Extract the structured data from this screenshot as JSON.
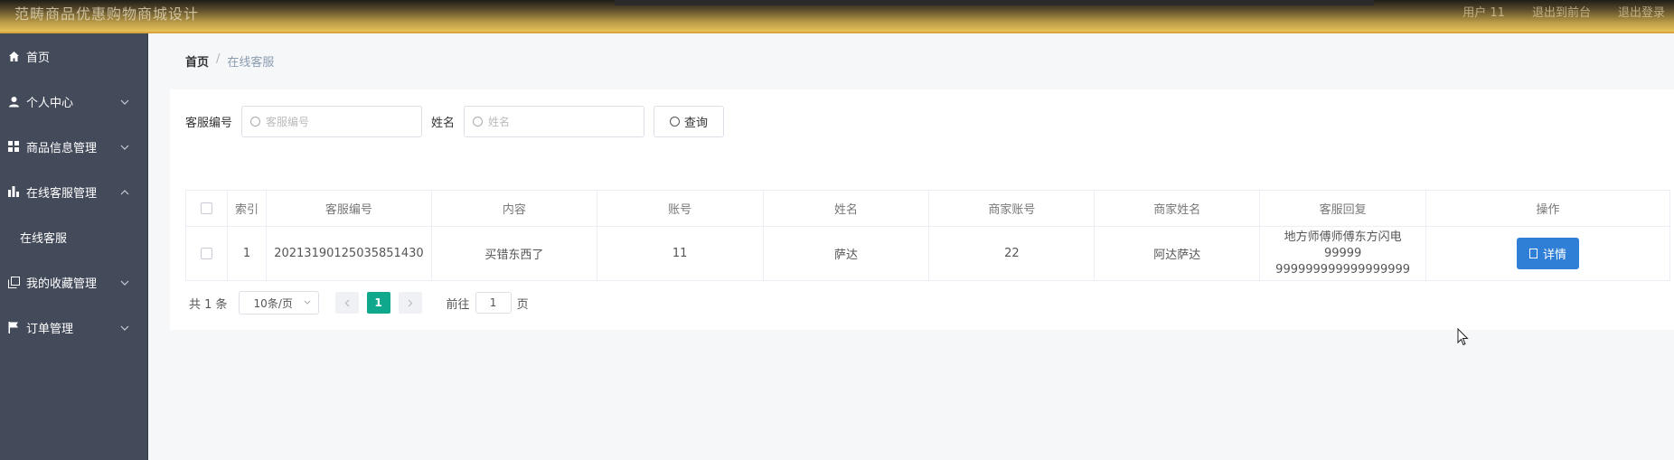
{
  "header": {
    "title": "范畴商品优惠购物商城设计",
    "right_items": [
      "用户 11",
      "退出到前台",
      "退出登录"
    ]
  },
  "sidebar": {
    "items": [
      {
        "label": "首页",
        "icon": "home-icon",
        "expandable": false
      },
      {
        "label": "个人中心",
        "icon": "user-icon",
        "expandable": true
      },
      {
        "label": "商品信息管理",
        "icon": "grid-icon",
        "expandable": true
      },
      {
        "label": "在线客服管理",
        "icon": "bar-chart-icon",
        "expandable": true,
        "expanded": true
      },
      {
        "label": "我的收藏管理",
        "icon": "copy-icon",
        "expandable": true
      },
      {
        "label": "订单管理",
        "icon": "flag-icon",
        "expandable": true
      }
    ],
    "sub_item": "在线客服"
  },
  "breadcrumb": {
    "home": "首页",
    "separator": "/",
    "current": "在线客服"
  },
  "search": {
    "field1_label": "客服编号",
    "field1_placeholder": "客服编号",
    "field2_label": "姓名",
    "field2_placeholder": "姓名",
    "query_label": "查询"
  },
  "table": {
    "headers": [
      "",
      "索引",
      "客服编号",
      "内容",
      "账号",
      "姓名",
      "商家账号",
      "商家姓名",
      "客服回复",
      "操作"
    ],
    "rows": [
      {
        "index": "1",
        "service_no": "20213190125035851430",
        "content": "买错东西了",
        "account": "11",
        "name": "萨达",
        "merchant_account": "22",
        "merchant_name": "阿达萨达",
        "reply_line1": "地方师傅师傅东方闪电99999",
        "reply_line2": "999999999999999999",
        "action": "详情"
      }
    ]
  },
  "pagination": {
    "total": "共 1 条",
    "page_size": "10条/页",
    "current_page": "1",
    "goto_prefix": "前往",
    "goto_value": "1",
    "goto_suffix": "页"
  },
  "colors": {
    "sidebar_bg": "#434a59",
    "accent_green": "#0fa88c",
    "primary_blue": "#2f7fd6",
    "header_gold": "#e8c35b"
  }
}
